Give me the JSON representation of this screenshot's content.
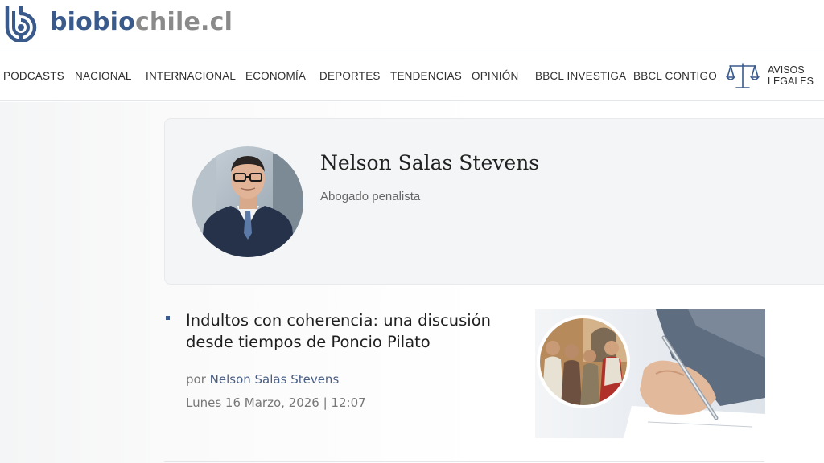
{
  "header": {
    "logo_part1": "biobio",
    "logo_part2": "chile.cl",
    "logo_mark_icon": "biobio-radio-logo-icon"
  },
  "nav": {
    "items": [
      {
        "label": "PODCASTS"
      },
      {
        "label": "NACIONAL"
      },
      {
        "label": "INTERNACIONAL"
      },
      {
        "label": "ECONOMÍA"
      },
      {
        "label": "DEPORTES"
      },
      {
        "label": "TENDENCIAS"
      },
      {
        "label": "OPINIÓN"
      },
      {
        "label": "BBCL INVESTIGA"
      },
      {
        "label": "BBCL CONTIGO"
      }
    ],
    "avisos_line1": "AVISOS",
    "avisos_line2": "LEGALES",
    "avisos_icon": "scales-of-justice-icon"
  },
  "author": {
    "name": "Nelson Salas Stevens",
    "role": "Abogado penalista"
  },
  "article": {
    "title": "Indultos con coherencia: una discusión desde tiempos de Poncio Pilato",
    "byline_prefix": "por",
    "byline_author": "Nelson Salas Stevens",
    "date": "Lunes 16 Marzo, 2026 | 12:07"
  },
  "colors": {
    "brand_blue": "#3a5a8c",
    "brand_gray": "#8a8a8a",
    "card_bg": "#f4f5f6"
  }
}
